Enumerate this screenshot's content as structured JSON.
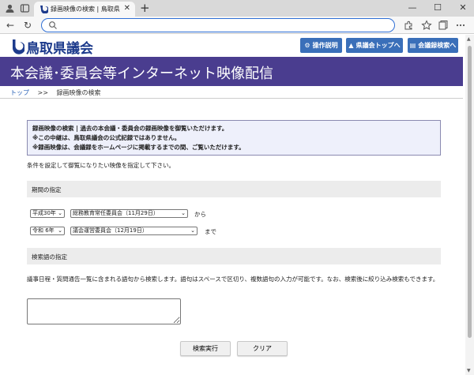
{
  "browser": {
    "tab_title": "録画映像の検索 | 鳥取県議会 本会議…",
    "tab_close": "✕",
    "new_tab": "+",
    "minimize": "—",
    "maximize": "☐",
    "close": "✕",
    "back": "←",
    "reload": "↻",
    "url": ""
  },
  "header": {
    "logo_text": "鳥取県議会",
    "buttons": [
      {
        "icon": "⚙",
        "label": "操作説明"
      },
      {
        "icon": "▲",
        "label": "県議会トップへ"
      },
      {
        "icon": "▤",
        "label": "会議録検索へ"
      }
    ]
  },
  "banner": {
    "title": "本会議･委員会等インターネット映像配信"
  },
  "breadcrumb": {
    "top": "トップ",
    "sep": ">>",
    "current": "録画映像の検索"
  },
  "notice": {
    "lines": [
      "録画映像の検索 | 過去の本会議・委員会の録画映像を御覧いただけます。",
      "※この中継は、鳥取県議会の公式記録ではありません。",
      "※録画映像は、会議録をホームページに掲載するまでの間、ご覧いただけます。"
    ]
  },
  "lead": "条件を設定して御覧になりたい映像を指定して下さい。",
  "period": {
    "heading": "期間の指定",
    "from_year": "平成30年",
    "from_meeting": "総務教育常任委員会（11月29日）",
    "from_label": "から",
    "to_year": "令和 6年",
    "to_meeting": "議会運営委員会（12月19日）",
    "to_label": "まで"
  },
  "keyword": {
    "heading": "検索語の指定",
    "description": "議事日程・質問通告一覧に含まれる語句から検索します。語句はスペースで区切り、複数語句の入力が可能です。なお、検索後に絞り込み検索もできます。",
    "value": ""
  },
  "actions": {
    "search": "検索実行",
    "clear": "クリア"
  },
  "colors": {
    "banner": "#4a3d8f",
    "header_button": "#3a6fb9",
    "accent": "#2f6fd6"
  }
}
